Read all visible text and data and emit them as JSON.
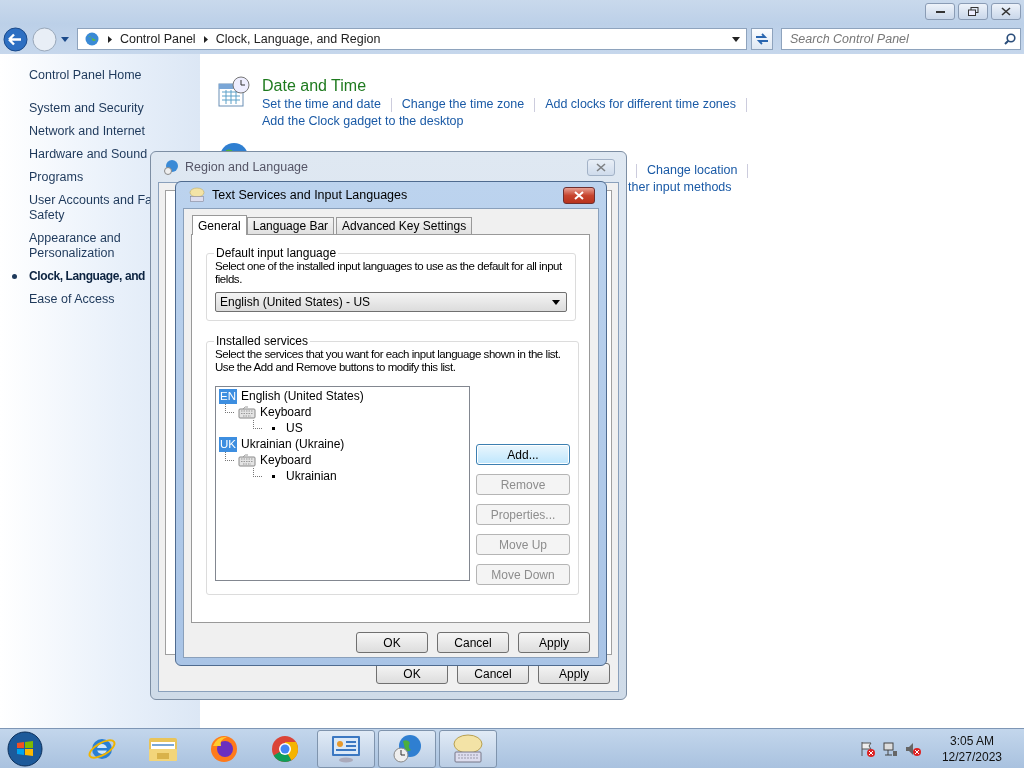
{
  "window": {
    "breadcrumb": [
      "Control Panel",
      "Clock, Language, and Region"
    ],
    "search": {
      "placeholder": "Search Control Panel"
    }
  },
  "sidebar": {
    "home": "Control Panel Home",
    "items": [
      {
        "label": "System and Security",
        "selected": false
      },
      {
        "label": "Network and Internet",
        "selected": false
      },
      {
        "label": "Hardware and Sound",
        "selected": false
      },
      {
        "label": "Programs",
        "selected": false
      },
      {
        "label": "User Accounts and Fa\nSafety",
        "selected": false
      },
      {
        "label": "Appearance and\nPersonalization",
        "selected": false
      },
      {
        "label": "Clock, Language, and",
        "selected": true
      },
      {
        "label": "Ease of Access",
        "selected": false
      }
    ]
  },
  "sections": [
    {
      "kind": "clock",
      "title": "Date and Time",
      "link_rows": [
        [
          "Set the time and date",
          "Change the time zone",
          "Add clocks for different time zones"
        ],
        [
          "Add the Clock gadget to the desktop"
        ]
      ]
    },
    {
      "kind": "globe",
      "link_rows": [
        [
          "Change location"
        ],
        [
          "ther input methods"
        ]
      ]
    }
  ],
  "region_dialog": {
    "title": "Region and Language",
    "buttons": [
      {
        "label": "OK"
      },
      {
        "label": "Cancel"
      },
      {
        "label": "Apply"
      }
    ]
  },
  "text_services_dialog": {
    "title": "Text Services and Input Languages",
    "tabs": [
      {
        "label": "General",
        "selected": true
      },
      {
        "label": "Language Bar",
        "selected": false
      },
      {
        "label": "Advanced Key Settings",
        "selected": false
      }
    ],
    "default_group": {
      "title": "Default input language",
      "description": "Select one of the installed input languages to use as the default for all input fields.",
      "value": "English (United States) - US"
    },
    "services_group": {
      "title": "Installed services",
      "description": "Select the services that you want for each input language shown in the list.\nUse the Add and Remove buttons to modify this list.",
      "tree": [
        {
          "kind": "language",
          "code": "EN",
          "label": "English (United States)",
          "children": [
            {
              "kind": "keyboard",
              "label": "Keyboard",
              "children": [
                {
                  "kind": "layout",
                  "label": "US"
                }
              ]
            }
          ]
        },
        {
          "kind": "language",
          "code": "UK",
          "label": "Ukrainian (Ukraine)",
          "children": [
            {
              "kind": "keyboard",
              "label": "Keyboard",
              "children": [
                {
                  "kind": "layout",
                  "label": "Ukrainian"
                }
              ]
            }
          ]
        }
      ],
      "buttons": [
        {
          "label": "Add...",
          "disabled": false,
          "highlighted": true
        },
        {
          "label": "Remove",
          "disabled": true,
          "highlighted": false
        },
        {
          "label": "Properties...",
          "disabled": true,
          "highlighted": false
        },
        {
          "label": "Move Up",
          "disabled": true,
          "highlighted": false
        },
        {
          "label": "Move Down",
          "disabled": true,
          "highlighted": false
        }
      ]
    },
    "buttons": [
      {
        "label": "OK"
      },
      {
        "label": "Cancel"
      },
      {
        "label": "Apply"
      }
    ]
  },
  "taskbar": {
    "items": [
      {
        "kind": "ie",
        "open": false
      },
      {
        "kind": "folder",
        "open": false
      },
      {
        "kind": "firefox",
        "open": false
      },
      {
        "kind": "chrome",
        "open": false
      },
      {
        "kind": "panel",
        "open": true
      },
      {
        "kind": "globe",
        "open": true
      },
      {
        "kind": "keyboard",
        "open": true
      }
    ],
    "time": "3:05 AM",
    "date": "12/27/2023"
  }
}
